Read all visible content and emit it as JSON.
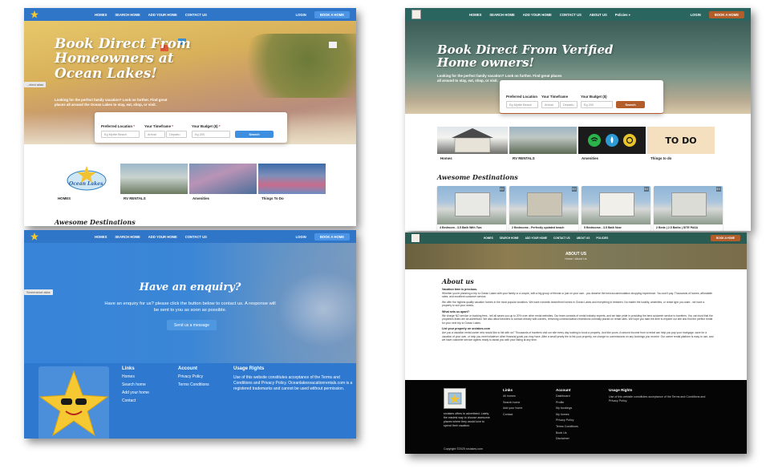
{
  "colors": {
    "blue_nav": "#2f76c8",
    "teal_nav": "#2b6560",
    "blue_btn": "#3f8fe0",
    "rust_btn": "#b35d2b",
    "footer_dark": "#050505"
  },
  "p1": {
    "nav": [
      "HOMES",
      "SEARCH HOME",
      "ADD YOUR HOME",
      "CONTACT US"
    ],
    "login": "LOGIN",
    "book": "BOOK A HOME",
    "title": "Book Direct From Homeowners at Ocean Lakes!",
    "subtitle": "Looking for the perfect family vacation? Look no further. Find great places all around the Ocean Lakes to stay, eat, shop, or visit.",
    "alias_tag": "...elect alias",
    "search": {
      "location_label": "Preferred Location",
      "location_placeholder": "Eg Myrtle Beach",
      "timeframe_label": "Your Timeframe",
      "arrival": "Arrival",
      "departure": "Departu",
      "budget_label": "Your Budget ($)",
      "budget_placeholder": "Eg 200",
      "button": "Search"
    },
    "cats": [
      "HOMES",
      "RV RENTALS",
      "Amenities",
      "Things To Do"
    ],
    "logo_text": "Ocean Lakes",
    "awesome": "Awesome Destinations"
  },
  "p2": {
    "nav": [
      "HOMES",
      "SEARCH HOME",
      "ADD YOUR HOME",
      "CONTACT US",
      "ABOUT US",
      "Policies"
    ],
    "login": "LOGIN",
    "book": "BOOK A HOME",
    "title": "Book Direct From Verified Home owners!",
    "subtitle": "Looking for the perfect family vacation? Look no further. Find great places all around to stay, eat, shop, or visit.",
    "search": {
      "location_label": "Preferred Location",
      "location_placeholder": "Eg Myrtle Beach",
      "timeframe_label": "Your Timeframe",
      "arrival": "Arrival",
      "departure": "Departu",
      "budget_label": "Your Budget ($)",
      "budget_placeholder": "Eg 200",
      "button": "Search"
    },
    "cats": [
      "Homes",
      "RV RENTALS",
      "Amenities",
      "Things to do"
    ],
    "todo_text": "TO DO",
    "awesome": "Awesome Destinations",
    "dests": [
      {
        "title": "4 Bedroom - 3.5 Bath With Two",
        "price": "$ 0"
      },
      {
        "title": "2 Bedrooms - Perfectly updated beach",
        "price": "$ 0"
      },
      {
        "title": "5 Bedrooms - 3.5 Bath Now",
        "price": "$ 0"
      },
      {
        "title": "2 Beds | 2.5 Baths | SITE PA6A",
        "price": "$ 0"
      }
    ]
  },
  "p3": {
    "nav": [
      "HOMES",
      "SEARCH HOME",
      "ADD YOUR HOME",
      "CONTACT US"
    ],
    "login": "LOGIN",
    "book": "BOOK A HOME",
    "title": "Have an enquiry?",
    "text": "Have an enquiry for us? please click the button below to contact us. A response will be sent to you as soon as possible.",
    "button": "Send us a message",
    "alias_tag": "Screenshot alias",
    "links_head": "Links",
    "links": [
      "Homes",
      "Search home",
      "Add your home",
      "Contact"
    ],
    "account_head": "Account",
    "account": [
      "Privacy Policy",
      "Terms Conditions"
    ],
    "rights_head": "Usage Rights",
    "rights_text": "Use of this website constitutes acceptance of the Terms and Conditions and Privacy Policy. Oceanlakesvacationrentals.com is a registered trademarks and cannot be used without permission."
  },
  "p4": {
    "nav": [
      "HOMES",
      "SEARCH HOME",
      "ADD YOUR HOME",
      "CONTACT US",
      "ABOUT US",
      "POLICIES"
    ],
    "book": "BOOK A HOME",
    "banner_title": "ABOUT US",
    "banner_crumb": "Home / About Us",
    "about_title": "About us",
    "sections": [
      {
        "head": "Vacation time is precious.",
        "text": "Whether you're planning a trip to Ocean Lakes with your family or a couple, with a big group of friends or just on your own - you deserve the best accommodation shopping experience. You won't pay. Thousands of homes, affordable rates, and excellent customer service."
      },
      {
        "head": "",
        "text": "We offer the highest quality vacation homes in the most popular locations. We have romantic beachfront homes in Ocean Lakes and everything in between. No matter the locality, amenities, or rental type you want - we have a property to suit your needs."
      },
      {
        "head": "What sets us apart?",
        "text": "We charge NO service or booking fees - tell all saves you up to 20% over other rental websites. Our team consists of rental industry experts, and we take pride in providing the best customer service to travelers. You can trust that the properties listed are as advertised. We also allow travelers to contact directly with owners, removing communication restrictions normally placed on rental sites. We hope you take the time to explore our site and find the perfect rental for your next trip to Ocean Lakes."
      },
      {
        "head": "List your property on srclakes.com",
        "text": "Are you a vacation rental owner who would like to list with us? Thousands of travelers visit our site every day looking to book a property. Just like yours. A second income from a rental can help you pay your mortgage, save for a vacation of your own, or help you meet whatever other financial goals you may have. After a small yearly fee to list your property, we charge no commissions on any bookings you receive. Our owner rental platform is easy to use, and we have customer service agents ready to assist you with your listing at any time."
      }
    ],
    "foot_desc": "srclakes offers to advertised. Lately the easiest way to choose awesome places where they would love to spend their vacation.",
    "links_head": "Links",
    "links": [
      "All homes",
      "Search home",
      "Add your home",
      "Contact"
    ],
    "account_head": "Account",
    "account": [
      "Dashboard",
      "Profile",
      "My bookings",
      "My homes",
      "Privacy Policy",
      "Terms Conditions",
      "Book Us",
      "Disclaimer"
    ],
    "rights_head": "Usage Rights",
    "rights_text": "Use of this website constitutes acceptance of the Terms and Conditions and Privacy Policy.",
    "copyright": "Copyright ©2025 srclakes.com"
  }
}
